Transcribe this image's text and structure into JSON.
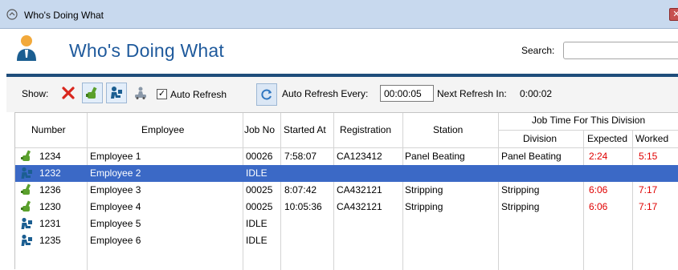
{
  "window": {
    "title": "Who's Doing What",
    "close_glyph": "✕"
  },
  "header": {
    "title": "Who's Doing What",
    "search_label": "Search:",
    "search_value": ""
  },
  "toolbar": {
    "show_label": "Show:",
    "auto_refresh_label": "Auto Refresh",
    "auto_refresh_checked": true,
    "auto_refresh_every_label": "Auto Refresh Every:",
    "interval": "00:00:05",
    "next_refresh_label": "Next Refresh In:",
    "next_refresh_value": "0:00:02"
  },
  "grid": {
    "columns": {
      "number": "Number",
      "employee": "Employee",
      "job_no": "Job No",
      "started_at": "Started At",
      "registration": "Registration",
      "station": "Station",
      "job_time_group": "Job Time For This Division",
      "division": "Division",
      "expected": "Expected",
      "worked": "Worked"
    },
    "rows": [
      {
        "status": "working",
        "number": "1234",
        "employee": "Employee 1",
        "job_no": "00026",
        "started_at": "7:58:07",
        "registration": "CA123412",
        "station": "Panel Beating",
        "division": "Panel Beating",
        "expected": "2:24",
        "worked": "5:15"
      },
      {
        "status": "idle",
        "number": "1232",
        "employee": "Employee 2",
        "job_no": "IDLE",
        "started_at": "",
        "registration": "",
        "station": "",
        "division": "",
        "expected": "",
        "worked": "",
        "selected": true
      },
      {
        "status": "working",
        "number": "1236",
        "employee": "Employee 3",
        "job_no": "00025",
        "started_at": "8:07:42",
        "registration": "CA432121",
        "station": "Stripping",
        "division": "Stripping",
        "expected": "6:06",
        "worked": "7:17"
      },
      {
        "status": "working",
        "number": "1230",
        "employee": "Employee 4",
        "job_no": "00025",
        "started_at": "10:05:36",
        "registration": "CA432121",
        "station": "Stripping",
        "division": "Stripping",
        "expected": "6:06",
        "worked": "7:17"
      },
      {
        "status": "idle",
        "number": "1231",
        "employee": "Employee 5",
        "job_no": "IDLE",
        "started_at": "",
        "registration": "",
        "station": "",
        "division": "",
        "expected": "",
        "worked": ""
      },
      {
        "status": "idle",
        "number": "1235",
        "employee": "Employee 6",
        "job_no": "IDLE",
        "started_at": "",
        "registration": "",
        "station": "",
        "division": "",
        "expected": "",
        "worked": ""
      }
    ]
  },
  "colors": {
    "brand": "#1f5a9c",
    "header_bar": "#1e4d7b",
    "selection": "#3b69c6",
    "alert": "#e00000",
    "working_icon": "#5aa02c",
    "idle_icon": "#1b5e91"
  }
}
